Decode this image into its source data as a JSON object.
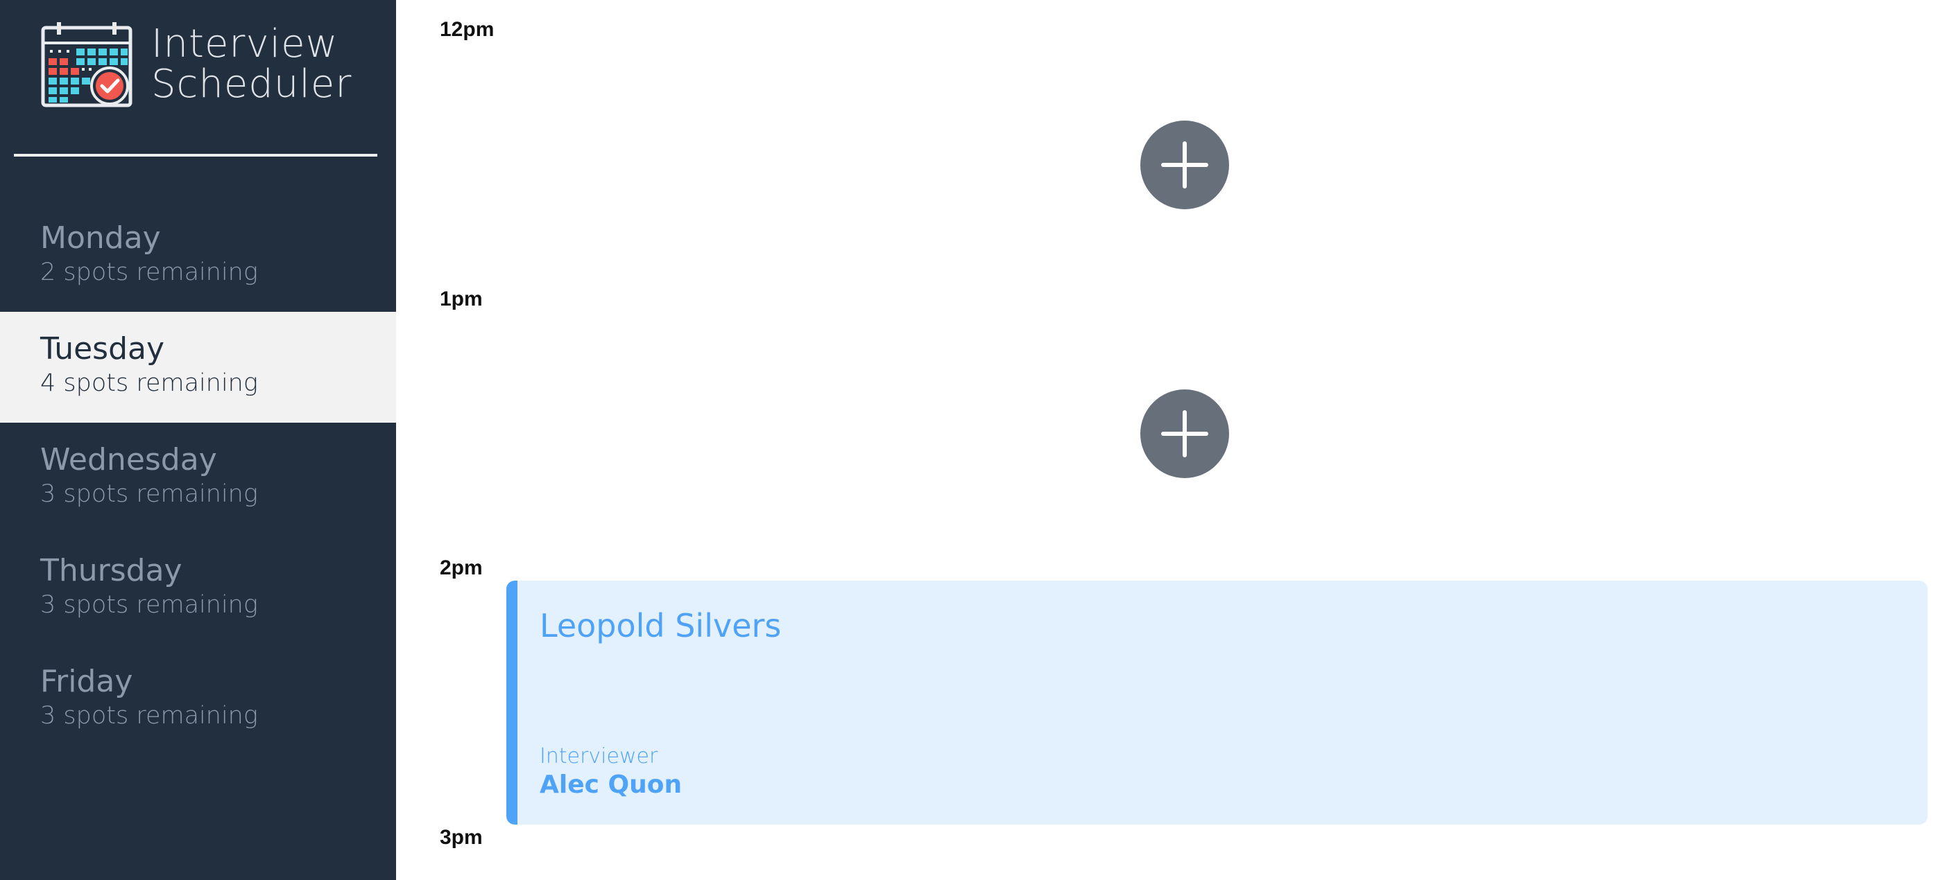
{
  "brand": {
    "title_line1": "Interview",
    "title_line2": "Scheduler",
    "logo": "calendar-check-icon"
  },
  "days": [
    {
      "name": "Monday",
      "spots": "2 spots remaining",
      "selected": false
    },
    {
      "name": "Tuesday",
      "spots": "4 spots remaining",
      "selected": true
    },
    {
      "name": "Wednesday",
      "spots": "3 spots remaining",
      "selected": false
    },
    {
      "name": "Thursday",
      "spots": "3 spots remaining",
      "selected": false
    },
    {
      "name": "Friday",
      "spots": "3 spots remaining",
      "selected": false
    }
  ],
  "schedule": {
    "times": [
      "12pm",
      "1pm",
      "2pm",
      "3pm"
    ],
    "add_icon": "plus-icon",
    "appointment": {
      "student": "Leopold Silvers",
      "interviewer_label": "Interviewer",
      "interviewer": "Alec Quon"
    }
  },
  "colors": {
    "sidebar_bg": "#222f3e",
    "selected_bg": "#f2f2f2",
    "accent": "#4fa3f7",
    "appointment_bg": "#e3f0fd",
    "add_button": "#666f7a"
  }
}
